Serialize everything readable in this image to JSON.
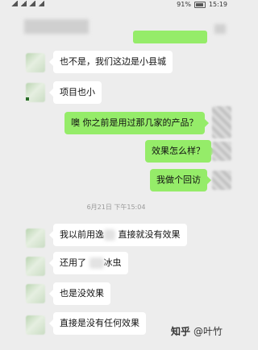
{
  "status_bar": {
    "battery": "91%",
    "time": "15:19"
  },
  "messages": [
    {
      "side": "left",
      "text": "也不是，我们这边是小县城"
    },
    {
      "side": "left",
      "text": "项目也小"
    },
    {
      "side": "right",
      "text": "噢  你之前是用过那几家的产品？"
    },
    {
      "side": "right",
      "text": "效果怎么样？"
    },
    {
      "side": "right",
      "text": "我做个回访"
    },
    {
      "side": "left",
      "text_before": "我以前用逸",
      "text_after": "直接就没有效果"
    },
    {
      "side": "left",
      "text_before": "还用了",
      "text_after": "冰虫"
    },
    {
      "side": "left",
      "text": "也是没效果"
    },
    {
      "side": "left",
      "text": "直接是没有任何效果"
    }
  ],
  "timestamp": "6月21日 下午15:04",
  "watermark": {
    "site": "知乎",
    "author": "@叶竹"
  }
}
